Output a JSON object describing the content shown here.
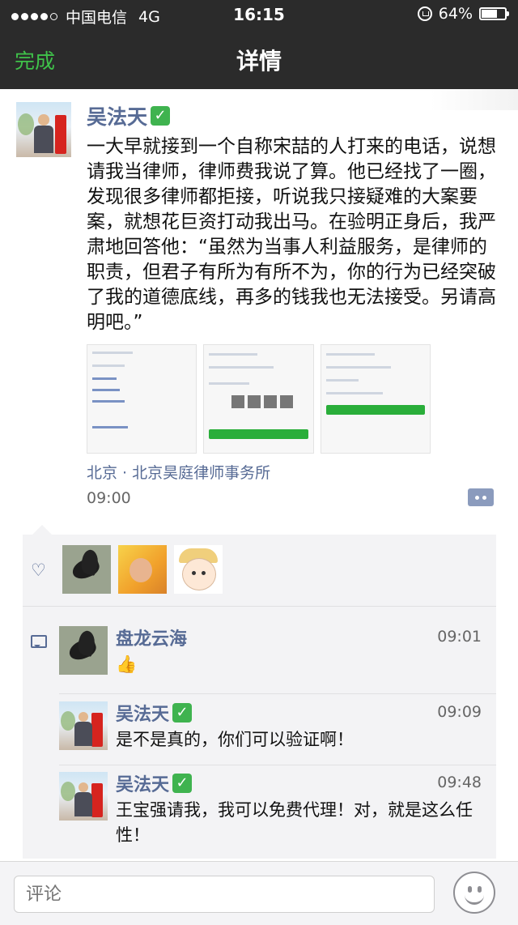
{
  "status_bar": {
    "carrier": "中国电信",
    "network": "4G",
    "time": "16:15",
    "battery": "64%"
  },
  "nav": {
    "back_label": "完成",
    "title": "详情"
  },
  "post": {
    "author": "吴法天",
    "verified_badge": "✅",
    "text": "一大早就接到一个自称宋喆的人打来的电话，说想请我当律师，律师费我说了算。他已经找了一圈，发现很多律师都拒接，听说我只接疑难的大案要案，就想花巨资打动我出马。在验明正身后，我严肃地回答他：“虽然为当事人利益服务，是律师的职责，但君子有所为有所不为，你的行为已经突破了我的道德底线，再多的钱我也无法接受。另请高明吧。”",
    "location": "北京 · 北京昊庭律师事务所",
    "time": "09:00",
    "attached_screenshots": [
      {
        "lines": [
          "138-0130-9827",
          "王宝强经纪人",
          "发送信息",
          "添加联系人",
          "加入黑名单"
        ]
      },
      {
        "lines": [
          "电话号码",
          "地区",
          "个人相册"
        ]
      },
      {
        "lines": [
          "地区",
          "个性签名",
          "社交资料",
          "来源"
        ]
      }
    ]
  },
  "likes": {
    "icon": "heart-icon",
    "avatars": [
      "crow",
      "child",
      "cartoon-girl"
    ]
  },
  "comments": [
    {
      "name": "盘龙云海",
      "verified": "",
      "time": "09:01",
      "text": "👍",
      "avatar": "crow"
    },
    {
      "name": "吴法天",
      "verified": "✅",
      "time": "09:09",
      "text": "是不是真的，你们可以验证啊！",
      "avatar": "lawyer"
    },
    {
      "name": "吴法天",
      "verified": "✅",
      "time": "09:48",
      "text": "王宝强请我，我可以免费代理！对，就是这么任性！",
      "avatar": "lawyer"
    }
  ],
  "input": {
    "placeholder": "评论"
  },
  "colors": {
    "nav_bg": "#2b2b2b",
    "accent_green": "#3fc24a",
    "name_blue": "#576b95",
    "panel_bg": "#f3f3f5"
  }
}
